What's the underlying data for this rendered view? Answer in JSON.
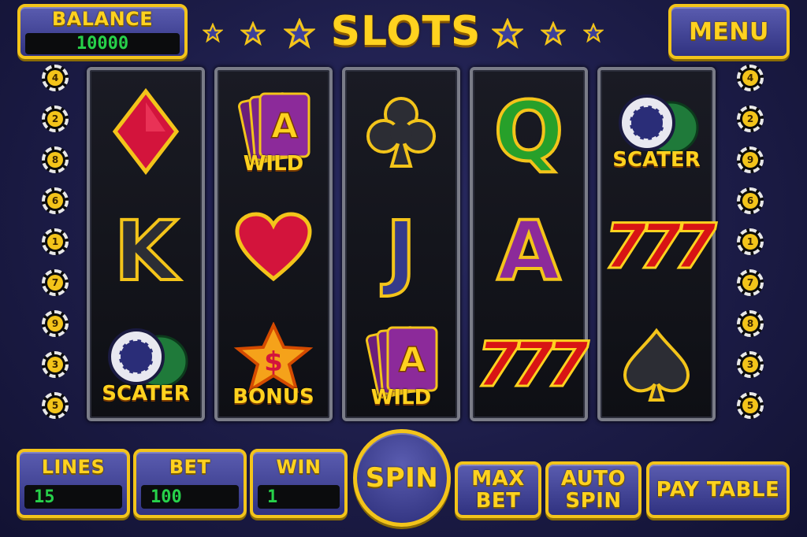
{
  "header": {
    "balance_label": "BALANCE",
    "balance_value": "10000",
    "title": "SLOTS",
    "menu_label": "MENU"
  },
  "paylines": {
    "left": [
      "4",
      "2",
      "8",
      "6",
      "1",
      "7",
      "9",
      "3",
      "5"
    ],
    "right": [
      "4",
      "2",
      "9",
      "6",
      "1",
      "7",
      "8",
      "3",
      "5"
    ]
  },
  "reels": [
    {
      "symbols": [
        {
          "name": "diamond-suit",
          "label": ""
        },
        {
          "name": "letter-k",
          "label": "K"
        },
        {
          "name": "poker-chips",
          "label": "SCATER"
        }
      ]
    },
    {
      "symbols": [
        {
          "name": "wild-cards",
          "label": "WILD",
          "letter": "A"
        },
        {
          "name": "heart-suit",
          "label": ""
        },
        {
          "name": "dollar-star",
          "label": "BONUS",
          "letter": "$"
        }
      ]
    },
    {
      "symbols": [
        {
          "name": "club-suit",
          "label": ""
        },
        {
          "name": "letter-j",
          "label": "J"
        },
        {
          "name": "wild-cards",
          "label": "WILD",
          "letter": "A"
        }
      ]
    },
    {
      "symbols": [
        {
          "name": "letter-q",
          "label": "Q"
        },
        {
          "name": "letter-a",
          "label": "A"
        },
        {
          "name": "triple-seven",
          "label": "777"
        }
      ]
    },
    {
      "symbols": [
        {
          "name": "poker-chips",
          "label": "SCATER"
        },
        {
          "name": "triple-seven",
          "label": "777"
        },
        {
          "name": "spade-suit",
          "label": ""
        }
      ]
    }
  ],
  "footer": {
    "lines_label": "LINES",
    "lines_value": "15",
    "bet_label": "BET",
    "bet_value": "100",
    "win_label": "WIN",
    "win_value": "1",
    "spin_label": "SPIN",
    "max_bet_line1": "MAX",
    "max_bet_line2": "BET",
    "auto_spin_line1": "AUTO",
    "auto_spin_line2": "SPIN",
    "pay_table_label": "PAY TABLE"
  },
  "colors": {
    "background": "#1c1c47",
    "accent_gold": "#f3c41a",
    "panel_blue": "#3a3c90",
    "lcd_green": "#27d14a"
  }
}
